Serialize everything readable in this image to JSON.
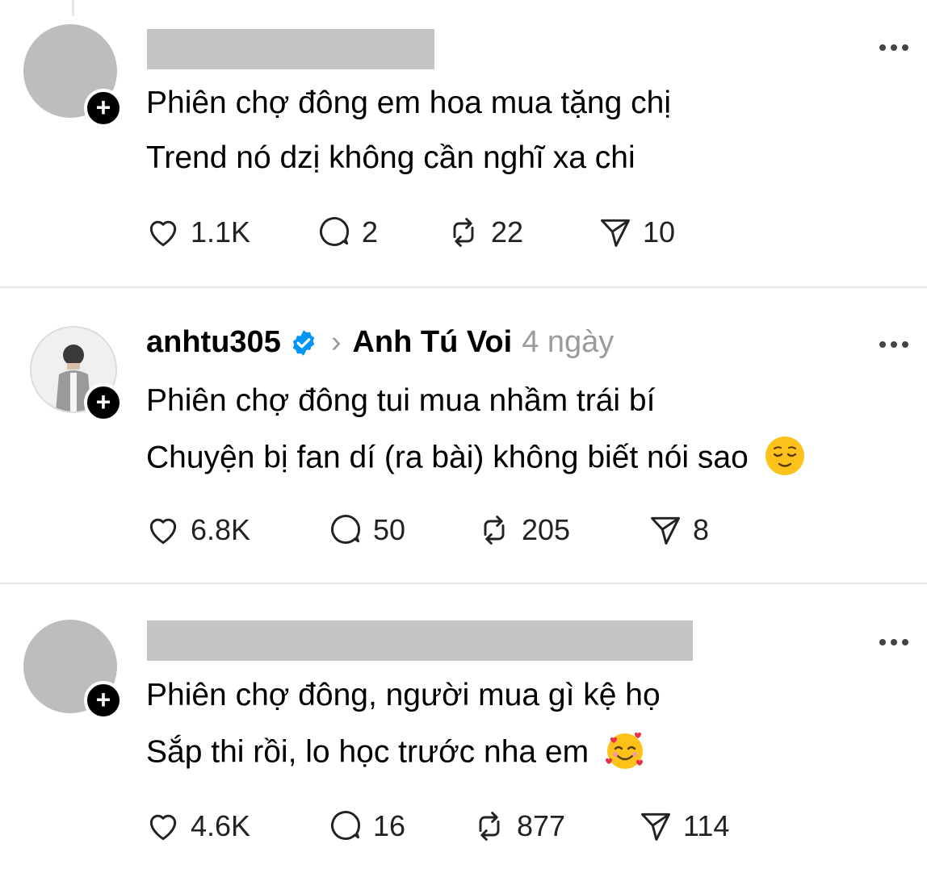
{
  "posts": [
    {
      "username": "",
      "reply_to": "",
      "time": "",
      "lines": [
        "Phiên chợ đông em hoa mua tặng chị",
        "Trend nó dzị không cần nghĩ xa chi"
      ],
      "likes": "1.1K",
      "comments": "2",
      "reposts": "22",
      "shares": "10"
    },
    {
      "username": "anhtu305",
      "reply_to": "Anh Tú Voi",
      "time": "4 ngày",
      "lines": [
        "Phiên chợ đông tui mua nhầm trái bí",
        "Chuyện bị fan dí (ra bài) không biết nói sao"
      ],
      "emoji": "relieved-face",
      "likes": "6.8K",
      "comments": "50",
      "reposts": "205",
      "shares": "8"
    },
    {
      "username": "",
      "reply_to": "",
      "time": "",
      "lines": [
        "Phiên chợ đông, người mua gì kệ họ",
        "Sắp thi rồi, lo học trước nha em"
      ],
      "emoji": "smiling-face-with-hearts",
      "likes": "4.6K",
      "comments": "16",
      "reposts": "877",
      "shares": "114"
    }
  ],
  "colors": {
    "verified": "#0095f6",
    "redaction": "#c4c4c4",
    "muted": "#9a9a9a"
  }
}
